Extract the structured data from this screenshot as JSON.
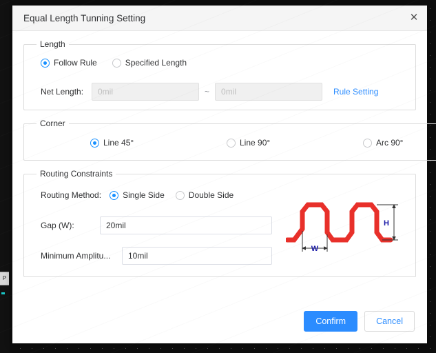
{
  "window": {
    "title": "Equal Length Tunning Setting",
    "close_icon": "close-icon",
    "close_glyph": "✕"
  },
  "length": {
    "legend": "Length",
    "mode_options": [
      {
        "label": "Follow Rule",
        "selected": true
      },
      {
        "label": "Specified Length",
        "selected": false
      }
    ],
    "net_length_label": "Net Length:",
    "net_length_min": {
      "value": "",
      "placeholder": "0mil",
      "disabled": true
    },
    "separator": "~",
    "net_length_max": {
      "value": "",
      "placeholder": "0mil",
      "disabled": true
    },
    "rule_setting_link": "Rule Setting"
  },
  "corner": {
    "legend": "Corner",
    "options": [
      {
        "label": "Line 45°",
        "selected": true
      },
      {
        "label": "Line 90°",
        "selected": false
      },
      {
        "label": "Arc 90°",
        "selected": false
      }
    ]
  },
  "routing_constraints": {
    "legend": "Routing Constraints",
    "routing_method_label": "Routing Method:",
    "routing_method_options": [
      {
        "label": "Single Side",
        "selected": true
      },
      {
        "label": "Double Side",
        "selected": false
      }
    ],
    "gap_label": "Gap (W):",
    "gap_value": "20mil",
    "gap_placeholder": "",
    "min_amplitude_label": "Minimum Amplitu...",
    "min_amplitude_value": "10mil",
    "min_amplitude_placeholder": "",
    "diagram": {
      "name": "serpentine-trace-diagram",
      "trace_color": "#e8302a",
      "dimension_color": "#1a1aa8",
      "width_label": "W",
      "height_label": "H"
    }
  },
  "footer": {
    "confirm_label": "Confirm",
    "cancel_label": "Cancel",
    "confirm_color": "#2b8cff",
    "cancel_text_color": "#2b8cff"
  },
  "background": {
    "panel_tab_label": "P"
  }
}
